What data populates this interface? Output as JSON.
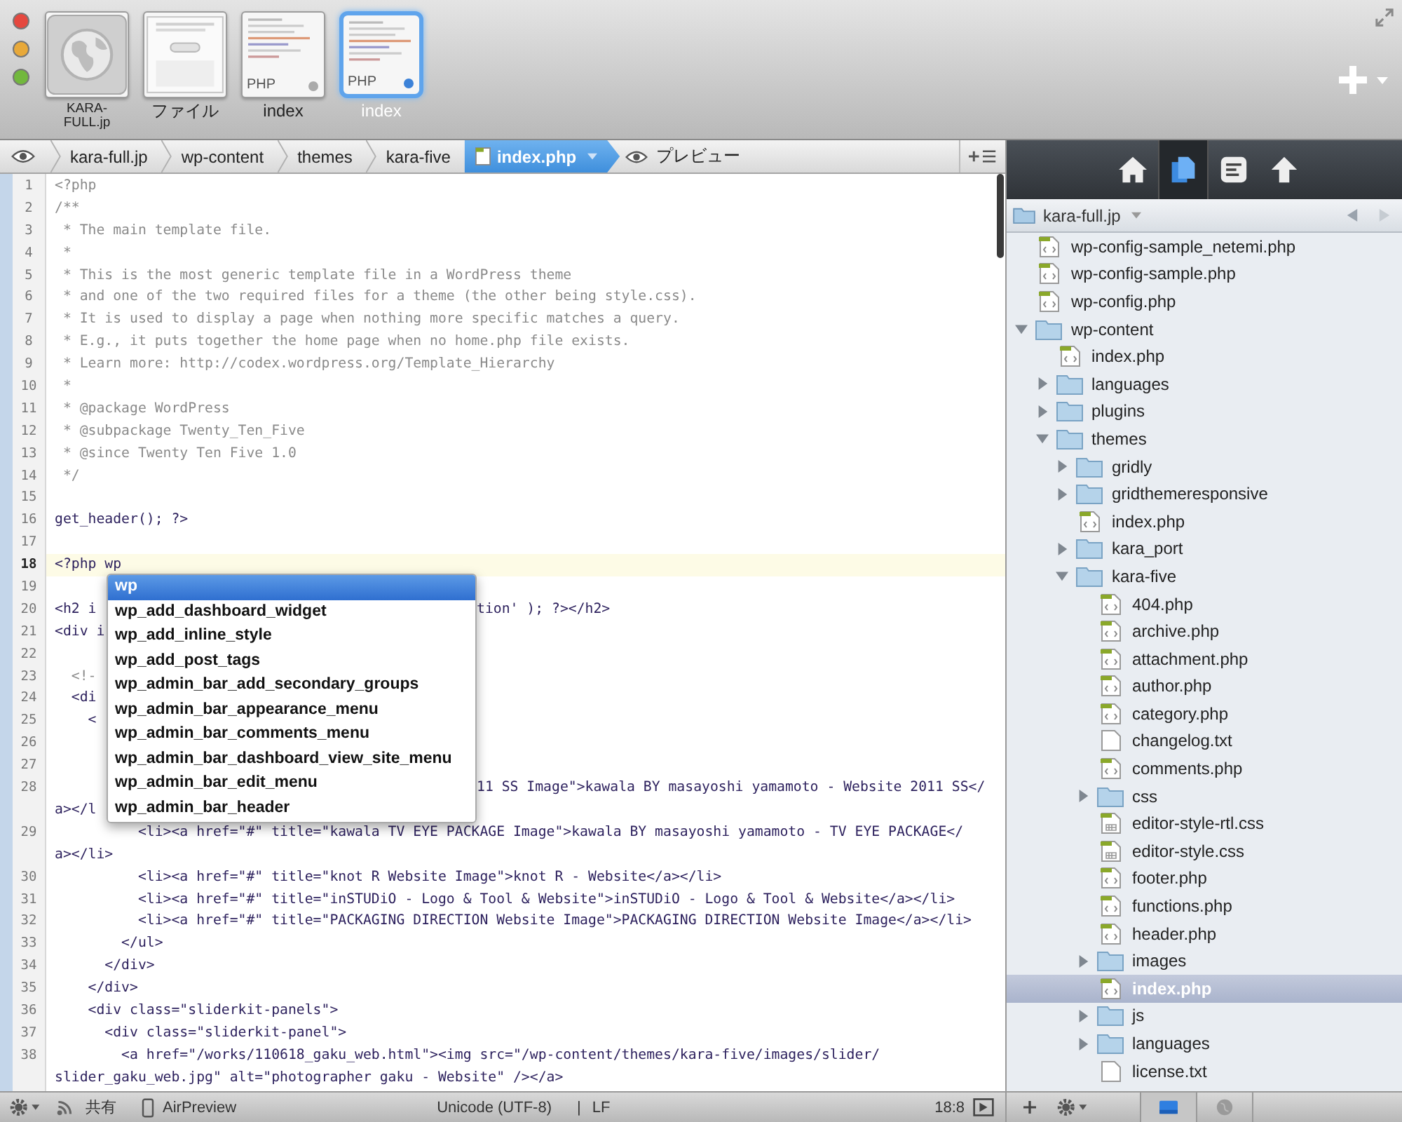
{
  "documents": [
    {
      "label": "KARA-FULL.jp",
      "kind": "site",
      "selected": false
    },
    {
      "label": "ファイル",
      "kind": "file",
      "selected": false
    },
    {
      "label": "index",
      "kind": "php",
      "tag": "PHP",
      "selected": false
    },
    {
      "label": "index",
      "kind": "php",
      "tag": "PHP",
      "selected": true
    }
  ],
  "breadcrumb": {
    "items": [
      {
        "label": "kara-full.jp",
        "selected": false
      },
      {
        "label": "wp-content",
        "selected": false
      },
      {
        "label": "themes",
        "selected": false
      },
      {
        "label": "kara-five",
        "selected": false
      },
      {
        "label": "index.php",
        "selected": true
      }
    ],
    "preview": "プレビュー"
  },
  "editor": {
    "lines": [
      {
        "n": "1",
        "kind": "php",
        "text": "<?php",
        "current": false
      },
      {
        "n": "2",
        "kind": "comment",
        "text": "/**",
        "current": false
      },
      {
        "n": "3",
        "kind": "comment",
        "text": " * The main template file.",
        "current": false
      },
      {
        "n": "4",
        "kind": "comment",
        "text": " *",
        "current": false
      },
      {
        "n": "5",
        "kind": "comment",
        "text": " * This is the most generic template file in a WordPress theme",
        "current": false
      },
      {
        "n": "6",
        "kind": "comment",
        "text": " * and one of the two required files for a theme (the other being style.css).",
        "current": false
      },
      {
        "n": "7",
        "kind": "comment",
        "text": " * It is used to display a page when nothing more specific matches a query.",
        "current": false
      },
      {
        "n": "8",
        "kind": "comment",
        "text": " * E.g., it puts together the home page when no home.php file exists.",
        "current": false
      },
      {
        "n": "9",
        "kind": "comment",
        "text": " * Learn more: http://codex.wordpress.org/Template_Hierarchy",
        "current": false
      },
      {
        "n": "10",
        "kind": "comment",
        "text": " *",
        "current": false
      },
      {
        "n": "11",
        "kind": "comment",
        "text": " * @package WordPress",
        "current": false
      },
      {
        "n": "12",
        "kind": "comment",
        "text": " * @subpackage Twenty_Ten_Five",
        "current": false
      },
      {
        "n": "13",
        "kind": "comment",
        "text": " * @since Twenty Ten Five 1.0",
        "current": false
      },
      {
        "n": "14",
        "kind": "comment",
        "text": " */",
        "current": false
      },
      {
        "n": "15",
        "kind": "code",
        "current": false
      },
      {
        "n": "16",
        "kind": "code",
        "text": "get_header(); ?>",
        "current": false
      },
      {
        "n": "17",
        "kind": "code",
        "current": false
      },
      {
        "n": "18",
        "kind": "code",
        "text": "<?php wp",
        "current": true
      },
      {
        "n": "19",
        "kind": "code",
        "current": false
      },
      {
        "n": "20",
        "kind": "code",
        "text": "<h2 i",
        "after": "tion' ); ?></h2>",
        "current": false
      },
      {
        "n": "21",
        "kind": "code",
        "text": "<div i",
        "current": false
      },
      {
        "n": "22",
        "kind": "code",
        "current": false
      },
      {
        "n": "23",
        "kind": "comment",
        "text": "  <!-",
        "current": false
      },
      {
        "n": "24",
        "kind": "code",
        "text": "  <di",
        "current": false
      },
      {
        "n": "25",
        "kind": "code",
        "text": "    <",
        "current": false
      },
      {
        "n": "26",
        "kind": "code",
        "current": false
      },
      {
        "n": "27",
        "kind": "code",
        "current": false
      },
      {
        "n": "28",
        "kind": "code",
        "after": "11 SS Image\">kawala BY masayoshi yamamoto - Website 2011 SS</",
        "wrap": "a></l",
        "current": false
      },
      {
        "n": "29",
        "kind": "code",
        "text": "          <li><a href=\"#\" title=\"kawala TV EYE PACKAGE Image\">kawala BY masayoshi yamamoto - TV EYE PACKAGE</",
        "wrap": "a></li>",
        "current": false
      },
      {
        "n": "30",
        "kind": "code",
        "text": "          <li><a href=\"#\" title=\"knot R Website Image\">knot R - Website</a></li>",
        "current": false
      },
      {
        "n": "31",
        "kind": "code",
        "text": "          <li><a href=\"#\" title=\"inSTUDiO - Logo & Tool & Website\">inSTUDiO - Logo & Tool & Website</a></li>",
        "current": false
      },
      {
        "n": "32",
        "kind": "code",
        "text": "          <li><a href=\"#\" title=\"PACKAGING DIRECTION Website Image\">PACKAGING DIRECTION Website Image</a></li>",
        "current": false
      },
      {
        "n": "33",
        "kind": "code",
        "text": "        </ul>",
        "current": false
      },
      {
        "n": "34",
        "kind": "code",
        "text": "      </div>",
        "current": false
      },
      {
        "n": "35",
        "kind": "code",
        "text": "    </div>",
        "current": false
      },
      {
        "n": "36",
        "kind": "code",
        "text": "    <div class=\"sliderkit-panels\">",
        "current": false
      },
      {
        "n": "37",
        "kind": "code",
        "text": "      <div class=\"sliderkit-panel\">",
        "current": false
      },
      {
        "n": "38",
        "kind": "code",
        "text": "        <a href=\"/works/110618_gaku_web.html\"><img src=\"/wp-content/themes/kara-five/images/slider/",
        "wrap": "slider_gaku_web.jpg\" alt=\"photographer gaku - Website\" /></a>",
        "current": false
      }
    ]
  },
  "autocomplete": {
    "items": [
      {
        "label": "wp",
        "selected": true
      },
      {
        "label": "wp_add_dashboard_widget",
        "selected": false
      },
      {
        "label": "wp_add_inline_style",
        "selected": false
      },
      {
        "label": "wp_add_post_tags",
        "selected": false
      },
      {
        "label": "wp_admin_bar_add_secondary_groups",
        "selected": false
      },
      {
        "label": "wp_admin_bar_appearance_menu",
        "selected": false
      },
      {
        "label": "wp_admin_bar_comments_menu",
        "selected": false
      },
      {
        "label": "wp_admin_bar_dashboard_view_site_menu",
        "selected": false
      },
      {
        "label": "wp_admin_bar_edit_menu",
        "selected": false
      },
      {
        "label": "wp_admin_bar_header",
        "selected": false
      }
    ]
  },
  "status_bar": {
    "share": "共有",
    "preview": "AirPreview",
    "encoding": "Unicode (UTF-8)",
    "separator": "|",
    "line_ending": "LF",
    "cursor": "18:8"
  },
  "sidebar": {
    "tabs": [
      {
        "kind": "home",
        "selected": false
      },
      {
        "kind": "files",
        "selected": true
      },
      {
        "kind": "notes",
        "selected": false
      },
      {
        "kind": "upload",
        "selected": false
      }
    ],
    "path": "kara-full.jp",
    "tree": [
      {
        "name": "wp-config-sample_netemi.php",
        "kind": "php",
        "selected": false
      },
      {
        "name": "wp-config-sample.php",
        "kind": "php",
        "selected": false
      },
      {
        "name": "wp-config.php",
        "kind": "php",
        "selected": false
      },
      {
        "name": "wp-content",
        "kind": "folder",
        "expanded": true,
        "selected": false,
        "children": [
          {
            "name": "index.php",
            "kind": "php",
            "selected": false
          },
          {
            "name": "languages",
            "kind": "folder",
            "expanded": false,
            "selected": false
          },
          {
            "name": "plugins",
            "kind": "folder",
            "expanded": false,
            "selected": false
          },
          {
            "name": "themes",
            "kind": "folder",
            "expanded": true,
            "selected": false,
            "children": [
              {
                "name": "gridly",
                "kind": "folder",
                "expanded": false,
                "selected": false
              },
              {
                "name": "gridthemeresponsive",
                "kind": "folder",
                "expanded": false,
                "selected": false
              },
              {
                "name": "index.php",
                "kind": "php",
                "selected": false
              },
              {
                "name": "kara_port",
                "kind": "folder",
                "expanded": false,
                "selected": false
              },
              {
                "name": "kara-five",
                "kind": "folder",
                "expanded": true,
                "selected": false,
                "children": [
                  {
                    "name": "404.php",
                    "kind": "php",
                    "selected": false
                  },
                  {
                    "name": "archive.php",
                    "kind": "php",
                    "selected": false
                  },
                  {
                    "name": "attachment.php",
                    "kind": "php",
                    "selected": false
                  },
                  {
                    "name": "author.php",
                    "kind": "php",
                    "selected": false
                  },
                  {
                    "name": "category.php",
                    "kind": "php",
                    "selected": false
                  },
                  {
                    "name": "changelog.txt",
                    "kind": "txt",
                    "selected": false
                  },
                  {
                    "name": "comments.php",
                    "kind": "php",
                    "selected": false
                  },
                  {
                    "name": "css",
                    "kind": "folder",
                    "expanded": false,
                    "selected": false
                  },
                  {
                    "name": "editor-style-rtl.css",
                    "kind": "css",
                    "selected": false
                  },
                  {
                    "name": "editor-style.css",
                    "kind": "css",
                    "selected": false
                  },
                  {
                    "name": "footer.php",
                    "kind": "php",
                    "selected": false
                  },
                  {
                    "name": "functions.php",
                    "kind": "php",
                    "selected": false
                  },
                  {
                    "name": "header.php",
                    "kind": "php",
                    "selected": false
                  },
                  {
                    "name": "images",
                    "kind": "folder",
                    "expanded": false,
                    "selected": false
                  },
                  {
                    "name": "index.php",
                    "kind": "php",
                    "selected": true
                  },
                  {
                    "name": "js",
                    "kind": "folder",
                    "expanded": false,
                    "selected": false
                  },
                  {
                    "name": "languages",
                    "kind": "folder",
                    "expanded": false,
                    "selected": false
                  },
                  {
                    "name": "license.txt",
                    "kind": "txt",
                    "selected": false
                  }
                ]
              }
            ]
          }
        ]
      }
    ],
    "bottom_tabs": [
      {
        "kind": "drive",
        "selected": true
      },
      {
        "kind": "globe",
        "selected": false
      }
    ]
  }
}
